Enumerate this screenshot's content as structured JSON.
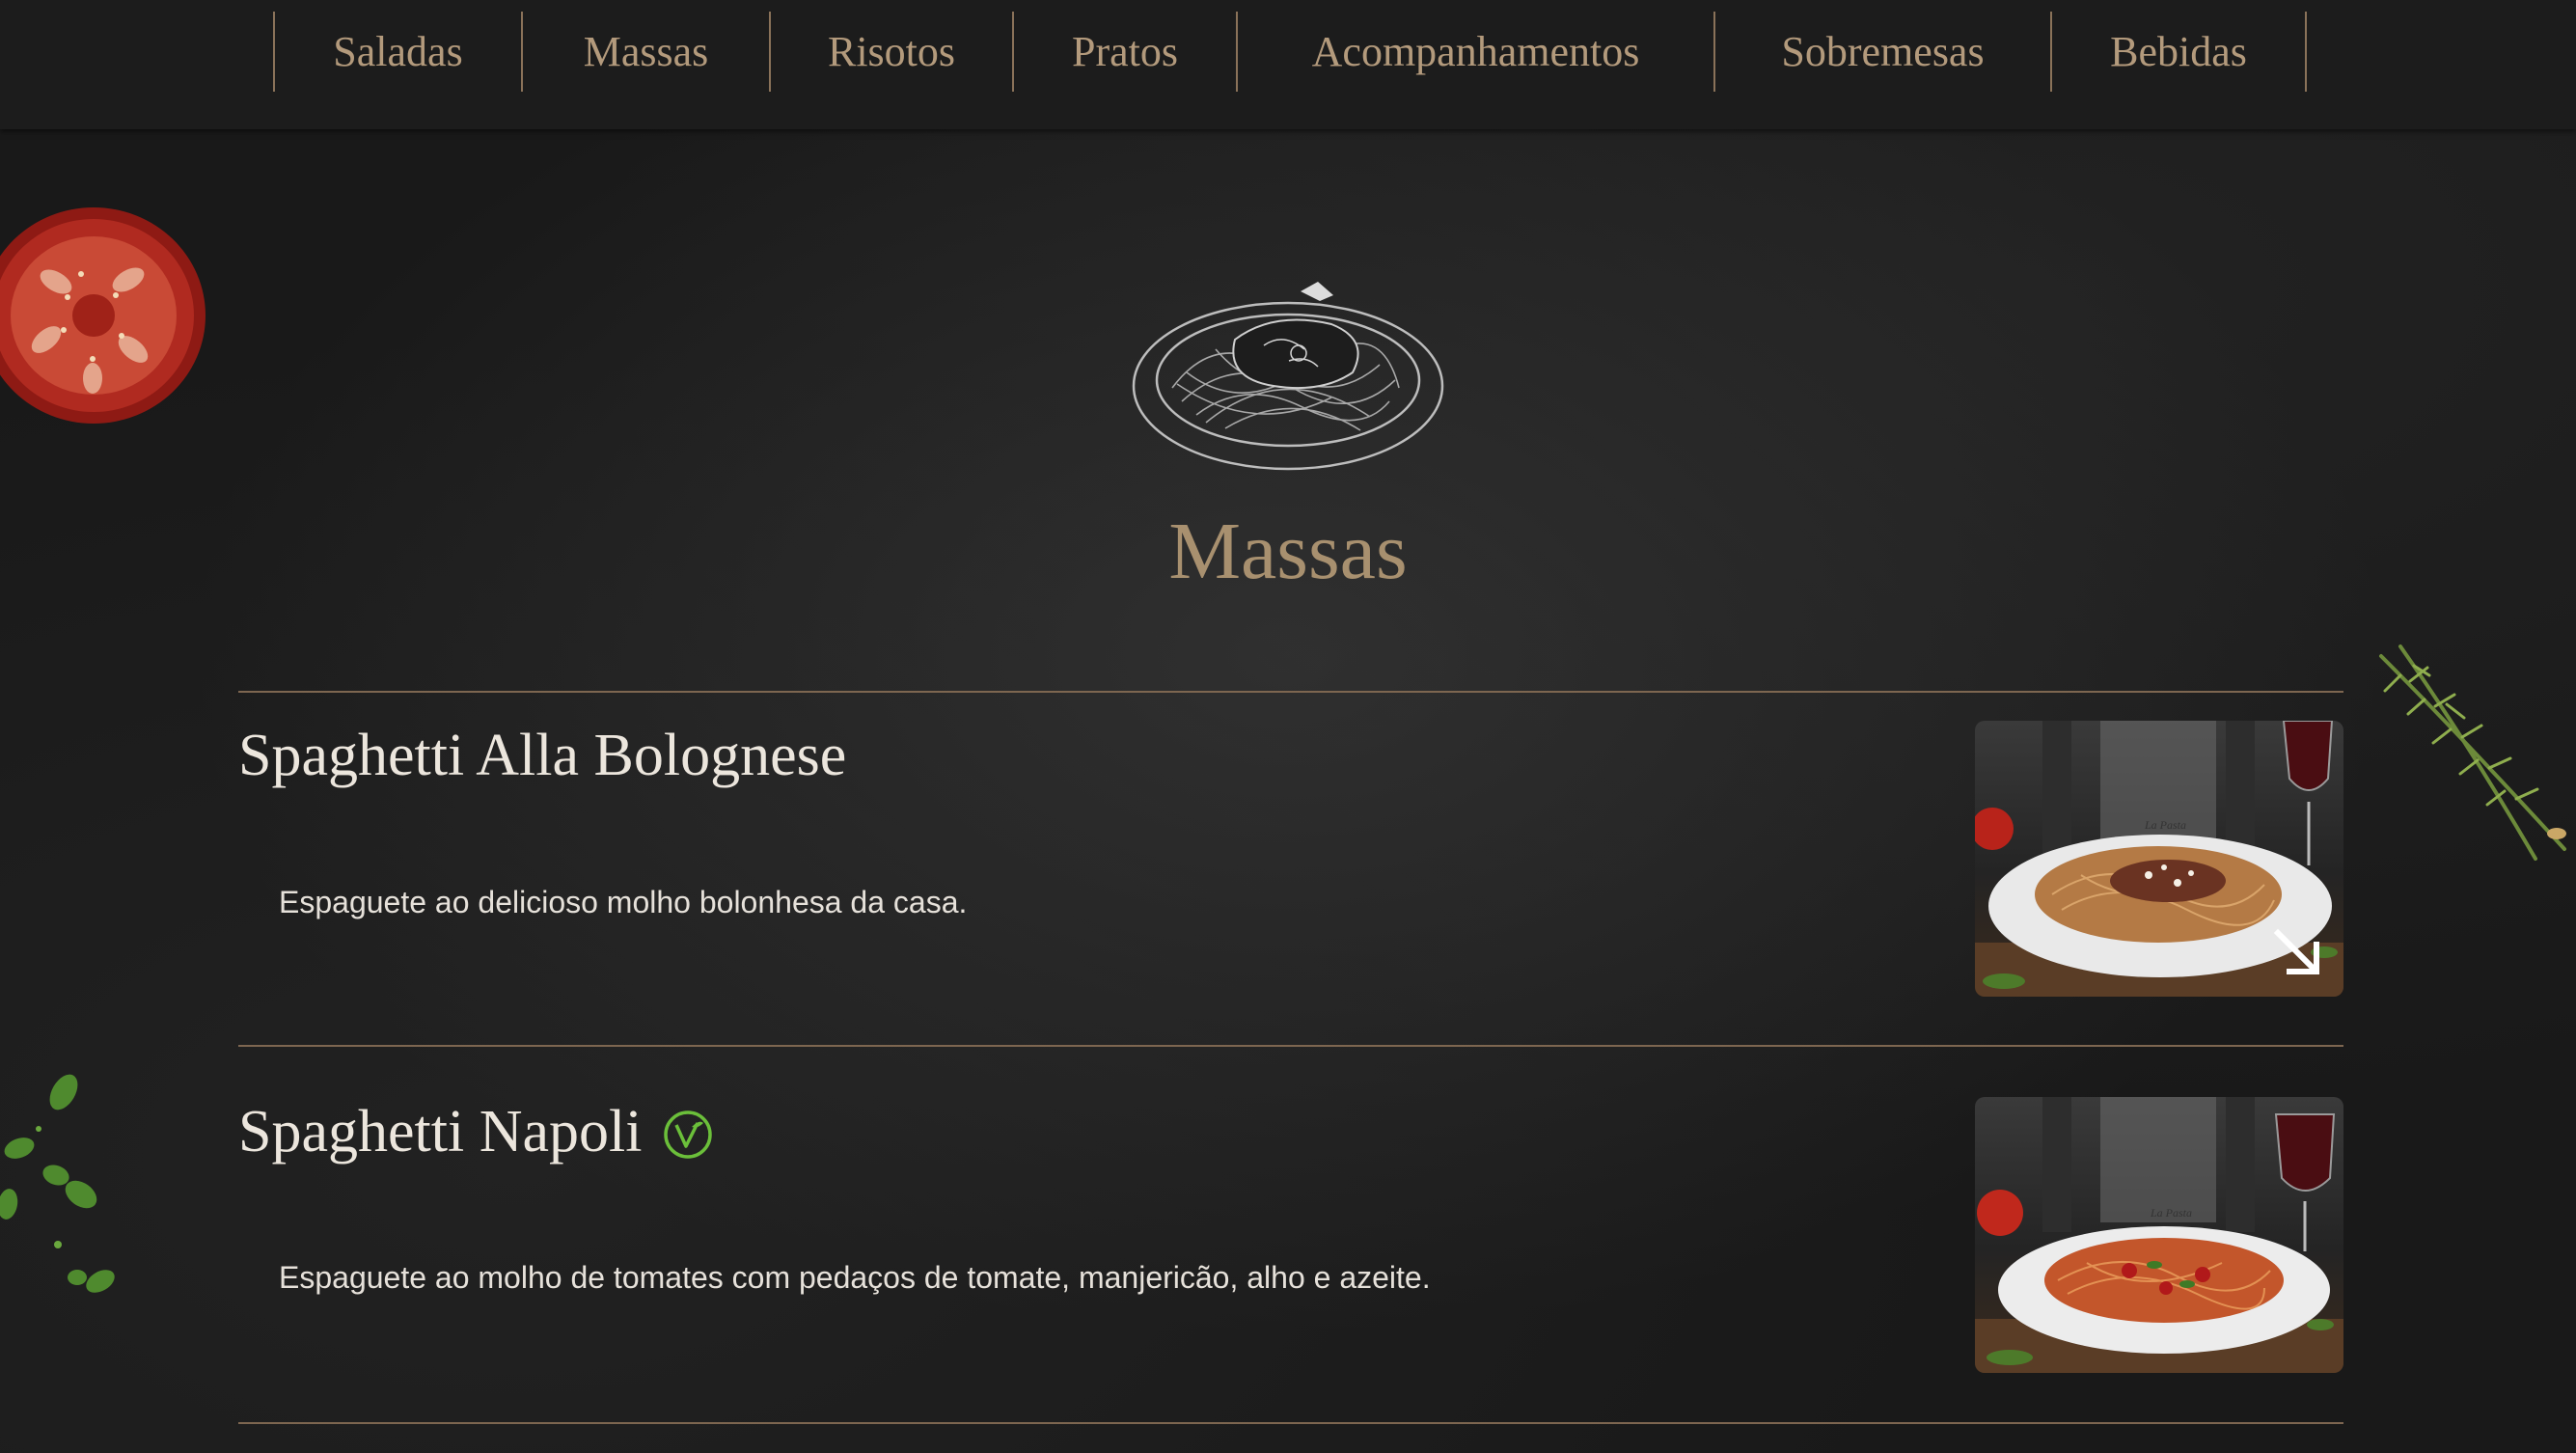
{
  "nav": {
    "items": [
      {
        "label": "Saladas"
      },
      {
        "label": "Massas"
      },
      {
        "label": "Risotos"
      },
      {
        "label": "Pratos"
      },
      {
        "label": "Acompanhamentos"
      },
      {
        "label": "Sobremesas"
      },
      {
        "label": "Bebidas"
      }
    ]
  },
  "section": {
    "title": "Massas",
    "icon": "pasta-plate-icon"
  },
  "menu_items": [
    {
      "name": "Spaghetti Alla Bolognese",
      "description": "Espaguete ao delicioso molho bolonhesa da casa.",
      "vegetarian": false,
      "photo_brand": "La Pasta",
      "photo_icon": "expand-arrow-icon"
    },
    {
      "name": "Spaghetti Napoli",
      "description": "Espaguete ao molho de tomates com pedaços de tomate, manjericão, alho e azeite.",
      "vegetarian": true,
      "badge_icon": "vegetarian-v-icon",
      "photo_brand": "La Pasta"
    }
  ],
  "colors": {
    "accent_gold": "#b39a7c",
    "divider": "#7d6650",
    "vegetarian_green": "#6bbf3a",
    "background": "#191919"
  }
}
